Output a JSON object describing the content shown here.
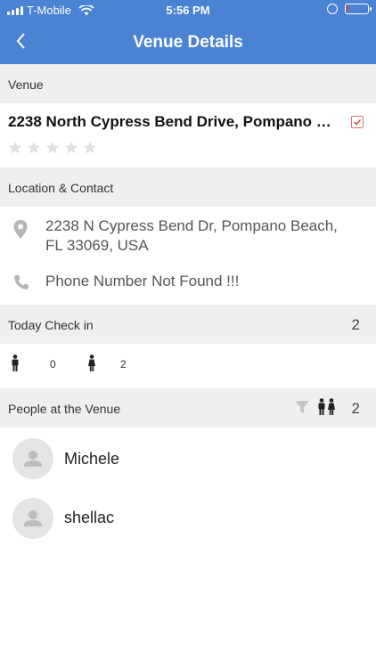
{
  "status": {
    "carrier": "T-Mobile",
    "time": "5:56 PM",
    "battery_level": 0.1,
    "battery_color": "#e23b3b"
  },
  "header": {
    "title": "Venue Details",
    "accent": "#4a82d4",
    "back_icon": "chevron-left-icon"
  },
  "venue": {
    "section_label": "Venue",
    "name": "2238 North Cypress Bend Drive, Pompano B...",
    "rating": 0,
    "rating_max": 5
  },
  "contact": {
    "section_label": "Location & Contact",
    "address": "2238 N Cypress Bend Dr, Pompano Beach, FL 33069, USA",
    "phone": "Phone Number Not Found !!!"
  },
  "checkin": {
    "section_label": "Today Check in",
    "total": "2",
    "male_count": "0",
    "female_count": "2"
  },
  "people": {
    "section_label": "People at the Venue",
    "count": "2",
    "list": [
      {
        "name": "Michele"
      },
      {
        "name": "shellac"
      }
    ]
  }
}
